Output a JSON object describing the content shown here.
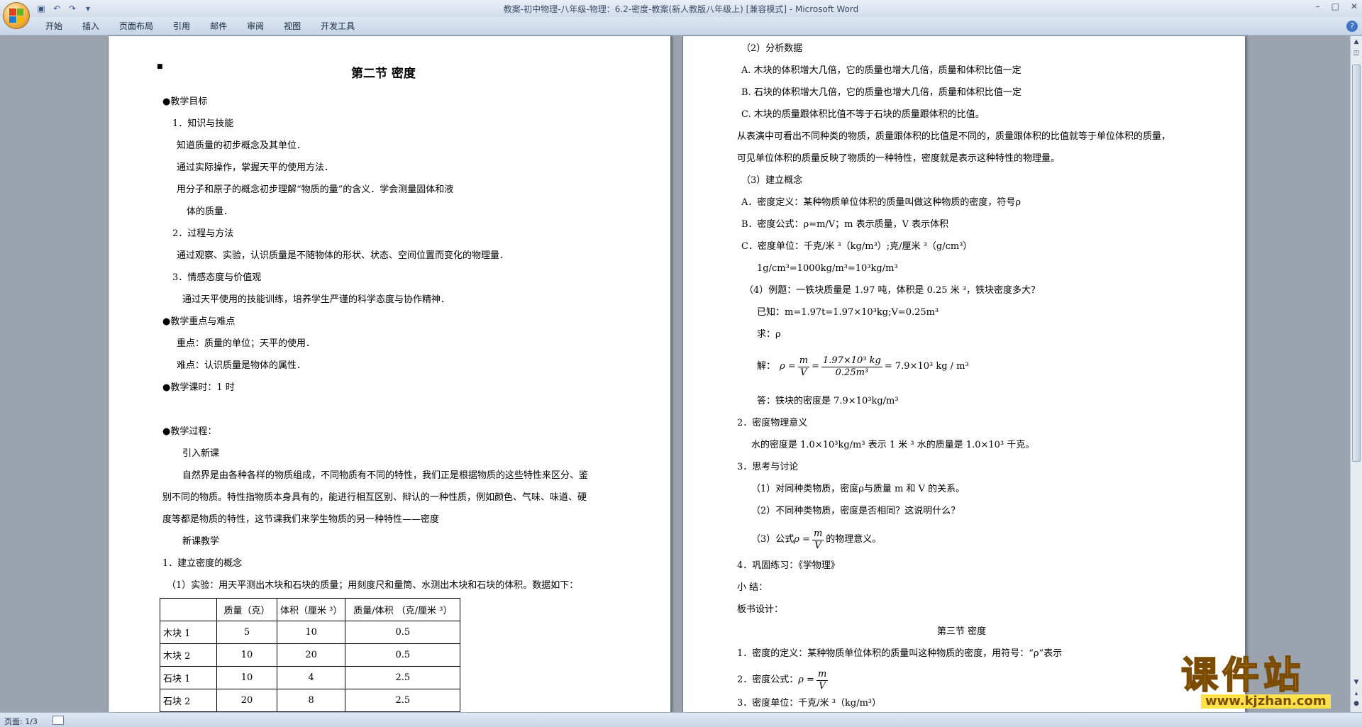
{
  "window": {
    "title": "教案-初中物理-八年级-物理：6.2-密度-教案(新人教版八年级上) [兼容模式] - Microsoft Word",
    "controls": [
      "–",
      "□",
      "✕"
    ]
  },
  "ribbon": {
    "tabs": [
      "开始",
      "插入",
      "页面布局",
      "引用",
      "邮件",
      "审阅",
      "视图",
      "开发工具"
    ],
    "help": "?"
  },
  "qat": [
    "save-icon",
    "undo-icon",
    "redo-icon",
    "customize-icon"
  ],
  "status": {
    "page": "页面: 1/3"
  },
  "watermark": {
    "main": "课件站",
    "url": "www.kjzhan.com"
  },
  "page1": {
    "title": "第二节  密度",
    "goals_head": "●教学目标",
    "g1": "1．知识与技能",
    "g1a": "知道质量的初步概念及其单位．",
    "g1b": "通过实际操作，掌握天平的使用方法．",
    "g1c": "用分子和原子的概念初步理解“物质的量”的含义．学会测量固体和液",
    "g1d": "体的质量．",
    "g2": "2．过程与方法",
    "g2a": "通过观察、实验，认识质量是不随物体的形状、状态、空间位置而变化的物理量．",
    "g3": "3．情感态度与价值观",
    "g3a": "通过天平使用的技能训练，培养学生严谨的科学态度与协作精神．",
    "key_head": "●教学重点与难点",
    "key1": "重点：质量的单位；天平的使用．",
    "key2": "难点：认识质量是物体的属性．",
    "hours": "●教学课时：1 时",
    "process": "●教学过程：",
    "intro": "引入新课",
    "p1": "自然界是由各种各样的物质组成，不同物质有不同的特性，我们正是根据物质的这些特性来区分、鉴",
    "p2": "别不同的物质。特性指物质本身具有的，能进行相互区别、辩认的一种性质，例如颜色、气味、味道、硬",
    "p3": "度等都是物质的特性，这节课我们来学生物质的另一种特性——密度",
    "new": "新课教学",
    "c1": "1．建立密度的概念",
    "exp": "（1）实验：用天平测出木块和石块的质量；用刻度尺和量筒、水测出木块和石块的体积。数据如下：",
    "table": {
      "header": [
        "",
        "质量（克）",
        "体积（厘米 ³）",
        "质量/体积  （克/厘米 ³）"
      ],
      "rows": [
        [
          "木块 1",
          "5",
          "10",
          "0.5"
        ],
        [
          "木块 2",
          "10",
          "20",
          "0.5"
        ],
        [
          "石块 1",
          "10",
          "4",
          "2.5"
        ],
        [
          "石块 2",
          "20",
          "8",
          "2.5"
        ]
      ]
    }
  },
  "page2": {
    "l01": "（2）分析数据",
    "l02": "A.  木块的体积增大几倍，它的质量也增大几倍，质量和体积比值一定",
    "l03": "B.  石块的体积增大几倍，它的质量也增大几倍，质量和体积比值一定",
    "l04": "C.  木块的质量跟体积比值不等于石块的质量跟体积的比值。",
    "l05": "从表演中可看出不同种类的物质，质量跟体积的比值是不同的，质量跟体积的比值就等于单位体积的质量，",
    "l06": "可见单位体积的质量反映了物质的一种特性，密度就是表示这种特性的物理量。",
    "l07": "（3）建立概念",
    "l08": "A．密度定义：某种物质单位体积的质量叫做这种物质的密度，符号ρ",
    "l09": "B．密度公式：ρ=m/V；m 表示质量，V 表示体积",
    "l10": "C．密度单位：千克/米 ³（kg/m³）;克/厘米 ³（g/cm³）",
    "l11": "1g/cm³=1000kg/m³=10³kg/m³",
    "l12": "（4）例题：一铁块质量是 1.97 吨，体积是 0.25 米 ³，铁块密度多大？",
    "l13": "已知：m=1.97t=1.97×10³kg;V=0.25m³",
    "l14": "求：ρ",
    "sol_label": "解：",
    "sol_rho": "ρ =",
    "sol_m": "m",
    "sol_v": "V",
    "sol_eq1": "=",
    "sol_num": "1.97×10³ kg",
    "sol_den": "0.25m³",
    "sol_result": "= 7.9×10³ kg / m³",
    "l16": "答：铁块的密度是 7.9×10³kg/m³",
    "l17": "2．密度物理意义",
    "l18": "水的密度是 1.0×10³kg/m³ 表示 1 米 ³ 水的质量是 1.0×10³ 千克。",
    "l19": "3．思考与讨论",
    "l20": "（1）对同种类物质，密度ρ与质量 m 和 V 的关系。",
    "l21": "（2）不同种类物质，密度是否相同？这说明什么？",
    "l22a": "（3）公式",
    "l22rho": "ρ =",
    "l22m": "m",
    "l22v": "V",
    "l22b": "的物理意义。",
    "l23": "4．巩固练习：《学物理》",
    "l24": "小    结：",
    "l25": "板书设计：",
    "l26": "第三节  密度",
    "l27": "1．密度的定义：某种物质单位体积的质量叫这种物质的密度，用符号：“ρ”表示",
    "l28a": "2．密度公式：",
    "l28rho": "ρ =",
    "l28m": "m",
    "l28v": "V",
    "l29": "3．密度单位：千克/米 ³（kg/m³）"
  }
}
